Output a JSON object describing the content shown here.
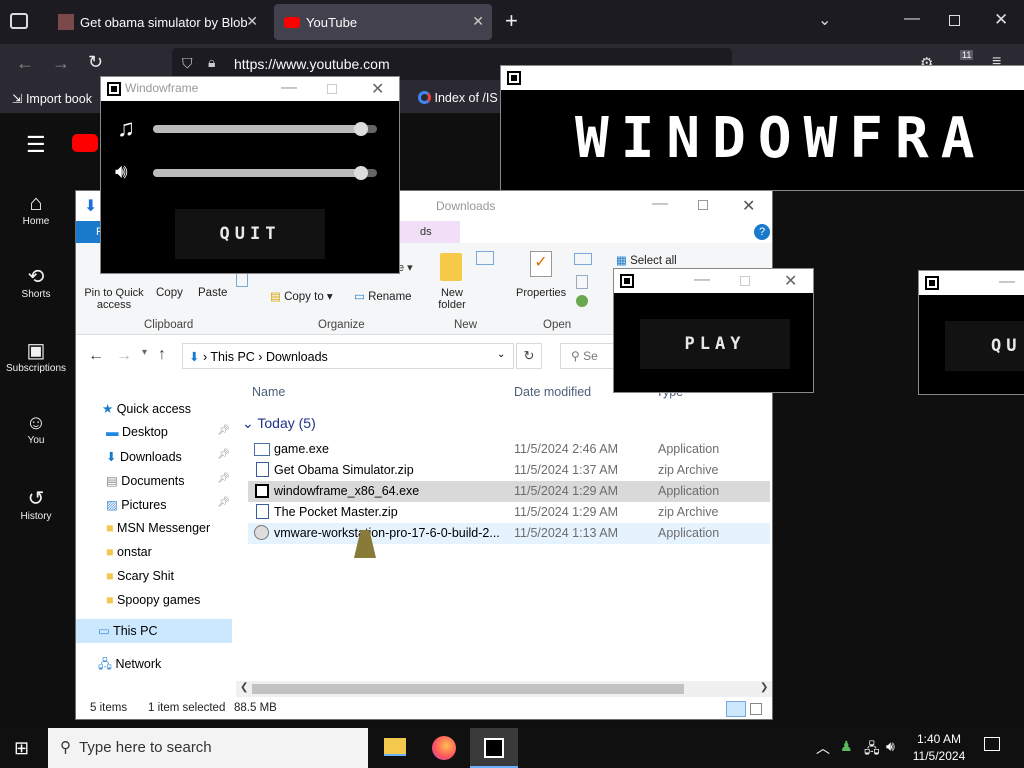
{
  "browser": {
    "tabs": [
      {
        "label": "Get obama simulator by Blob"
      },
      {
        "label": "YouTube"
      }
    ],
    "new_tab": "+",
    "url": "https://www.youtube.com",
    "notif_count": "11",
    "bookmarks": [
      {
        "label": "Import book"
      },
      {
        "label": "Index of /IS"
      }
    ]
  },
  "youtube": {
    "nav": [
      {
        "label": "Home"
      },
      {
        "label": "Shorts"
      },
      {
        "label": "Subscriptions"
      },
      {
        "label": "You"
      },
      {
        "label": "History"
      }
    ]
  },
  "explorer": {
    "title": "Downloads",
    "ribbon": {
      "pin": "Pin to Quick access",
      "copy": "Copy",
      "paste": "Paste",
      "copy_to": "Copy to",
      "rename": "Rename",
      "new_folder": "New folder",
      "properties": "Properties",
      "select_all": "Select all",
      "group_clipboard": "Clipboard",
      "group_organize": "Organize",
      "group_new": "New",
      "group_open": "Open",
      "tab_f": "F",
      "tab_ds": "ds",
      "tab_e": "e"
    },
    "breadcrumb": [
      "This PC",
      "Downloads"
    ],
    "search": "Se",
    "columns": {
      "name": "Name",
      "date": "Date modified",
      "type": "Type"
    },
    "group": "Today (5)",
    "files": [
      {
        "name": "game.exe",
        "date": "11/5/2024 2:46 AM",
        "type": "Application"
      },
      {
        "name": "Get Obama Simulator.zip",
        "date": "11/5/2024 1:37 AM",
        "type": "zip Archive"
      },
      {
        "name": "windowframe_x86_64.exe",
        "date": "11/5/2024 1:29 AM",
        "type": "Application"
      },
      {
        "name": "The Pocket Master.zip",
        "date": "11/5/2024 1:29 AM",
        "type": "zip Archive"
      },
      {
        "name": "vmware-workstation-pro-17-6-0-build-2...",
        "date": "11/5/2024 1:13 AM",
        "type": "Application"
      }
    ],
    "sidebar": [
      {
        "label": "Quick access"
      },
      {
        "label": "Desktop"
      },
      {
        "label": "Downloads"
      },
      {
        "label": "Documents"
      },
      {
        "label": "Pictures"
      },
      {
        "label": "MSN Messenger"
      },
      {
        "label": "onstar"
      },
      {
        "label": "Scary Shit"
      },
      {
        "label": "Spoopy games"
      },
      {
        "label": "This PC"
      },
      {
        "label": "Network"
      }
    ],
    "status": {
      "items": "5 items",
      "selected": "1 item selected",
      "size": "88.5 MB"
    }
  },
  "windowframe": {
    "settings_title": "Windowframe",
    "music_level": 0.93,
    "sound_level": 0.93,
    "quit": "QUIT",
    "play": "PLAY",
    "big_title": "WINDOWFRA",
    "partial_quit": "QU"
  },
  "taskbar": {
    "search": "Type here to search",
    "time": "1:40 AM",
    "date": "11/5/2024"
  }
}
